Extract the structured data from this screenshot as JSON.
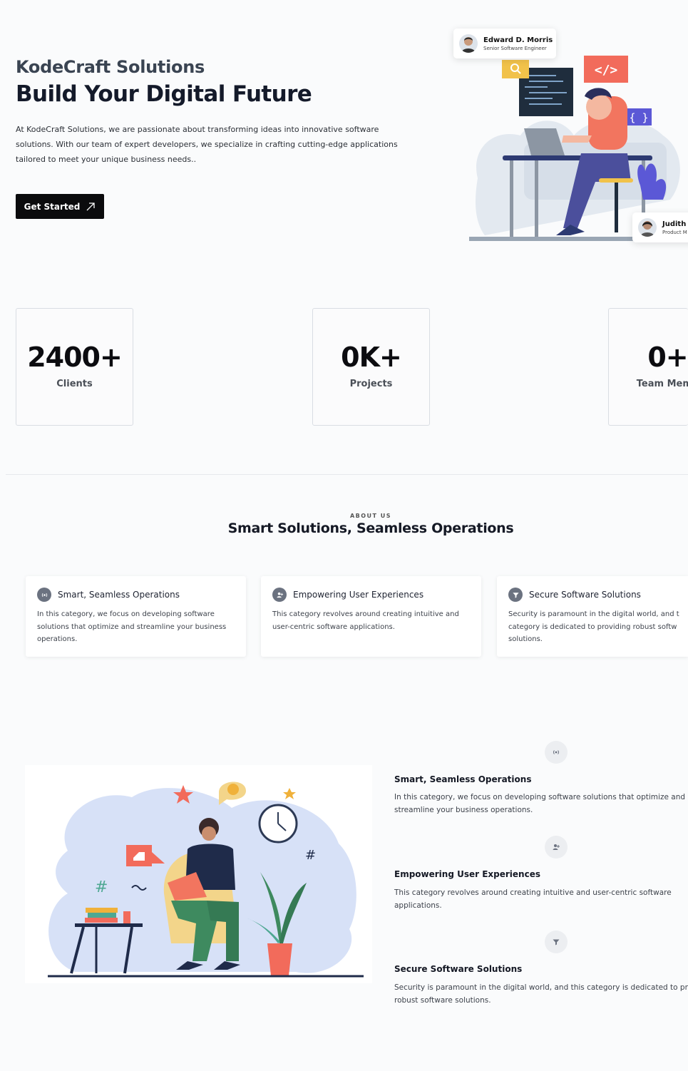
{
  "hero": {
    "brand": "KodeCraft Solutions",
    "headline": "Build Your Digital Future",
    "intro": "At KodeCraft Solutions, we are passionate about transforming ideas into innovative software solutions. With our team of expert developers, we specialize in crafting cutting-edge applications tailored to meet your unique business needs..",
    "cta_label": "Get Started",
    "cta_icon": "arrow-up-right-icon",
    "illustration": "developer-at-desk-illustration",
    "people": [
      {
        "name": "Edward D. Morris",
        "role": "Senior Software Engineer"
      },
      {
        "name": "Judith I",
        "role": "Product M"
      }
    ]
  },
  "stats": [
    {
      "value": "2400+",
      "label": "Clients"
    },
    {
      "value": "0K+",
      "label": "Projects"
    },
    {
      "value": "0+",
      "label": "Team Memb"
    }
  ],
  "about": {
    "eyebrow": "ABOUT US",
    "title": "Smart Solutions, Seamless Operations",
    "cards": [
      {
        "icon": "broadcast-icon",
        "title": "Smart, Seamless Operations",
        "text": "In this category, we focus on developing software solutions that optimize and streamline your business operations."
      },
      {
        "icon": "user-plus-icon",
        "title": "Empowering User Experiences",
        "text": "This category revolves around creating intuitive and user-centric software applications."
      },
      {
        "icon": "shield-filter-icon",
        "title": "Secure Software Solutions",
        "text": "Security is paramount in the digital world, and t category is dedicated to providing robust softw solutions."
      }
    ]
  },
  "features": {
    "illustration": "person-with-laptop-illustration",
    "items": [
      {
        "icon": "broadcast-icon",
        "title": "Smart, Seamless Operations",
        "text": "In this category, we focus on developing software solutions that optimize and streamline your business operations."
      },
      {
        "icon": "user-plus-icon",
        "title": "Empowering User Experiences",
        "text": "This category revolves around creating intuitive and user-centric software applications."
      },
      {
        "icon": "shield-filter-icon",
        "title": "Secure Software Solutions",
        "text": "Security is paramount in the digital world, and this category is dedicated to pr robust software solutions."
      }
    ]
  },
  "colors": {
    "accent_dark": "#0b0b0d",
    "code_red": "#f26b5b",
    "shirt_coral": "#f2755f",
    "pants_purple": "#4b4f9c",
    "search_yellow": "#f1c24a",
    "plant_purple": "#5b58d6"
  }
}
